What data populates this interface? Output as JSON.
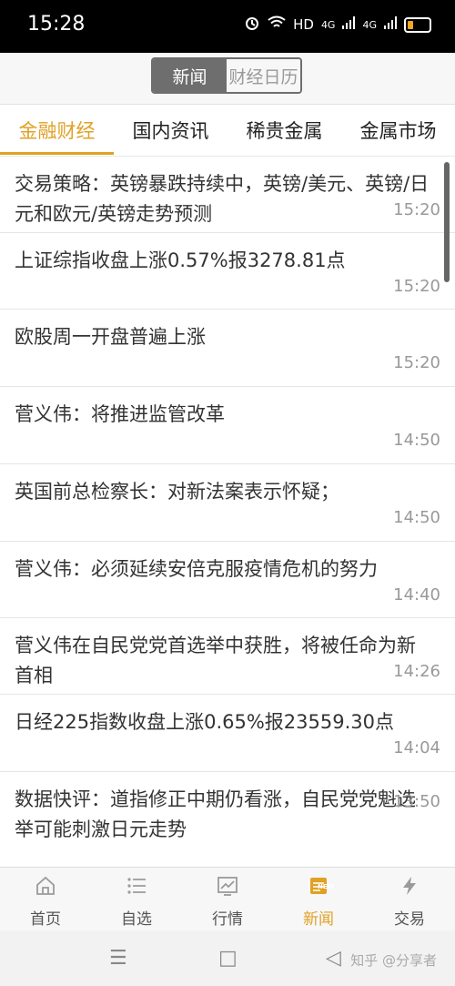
{
  "status": {
    "time": "15:28",
    "hd": "HD",
    "net1": "4G",
    "net2": "4G"
  },
  "segment": {
    "news": "新闻",
    "calendar": "财经日历"
  },
  "tabs": [
    "金融财经",
    "国内资讯",
    "稀贵金属",
    "金属市场"
  ],
  "news": [
    {
      "title": "交易策略：英镑暴跌持续中，英镑/美元、英镑/日元和欧元/英镑走势预测",
      "time": "15:20"
    },
    {
      "title": "上证综指收盘上涨0.57%报3278.81点",
      "time": "15:20"
    },
    {
      "title": "欧股周一开盘普遍上涨",
      "time": "15:20"
    },
    {
      "title": "菅义伟：将推进监管改革",
      "time": "14:50"
    },
    {
      "title": "英国前总检察长：对新法案表示怀疑；",
      "time": "14:50"
    },
    {
      "title": "菅义伟：必须延续安倍克服疫情危机的努力",
      "time": "14:40"
    },
    {
      "title": "菅义伟在自民党党首选举中获胜，将被任命为新首相",
      "time": "14:26"
    },
    {
      "title": "日经225指数收盘上涨0.65%报23559.30点",
      "time": "14:04"
    },
    {
      "title": "数据快评：道指修正中期仍看涨，自民党党魁选举可能刺激日元走势",
      "time": "13:50"
    }
  ],
  "nav": {
    "home": "首页",
    "watchlist": "自选",
    "market": "行情",
    "news": "新闻",
    "trade": "交易",
    "new_badge": "NEW"
  },
  "watermark": "知乎 @分享者",
  "colors": {
    "accent": "#e0a126",
    "segment_active": "#6e6e6e"
  }
}
